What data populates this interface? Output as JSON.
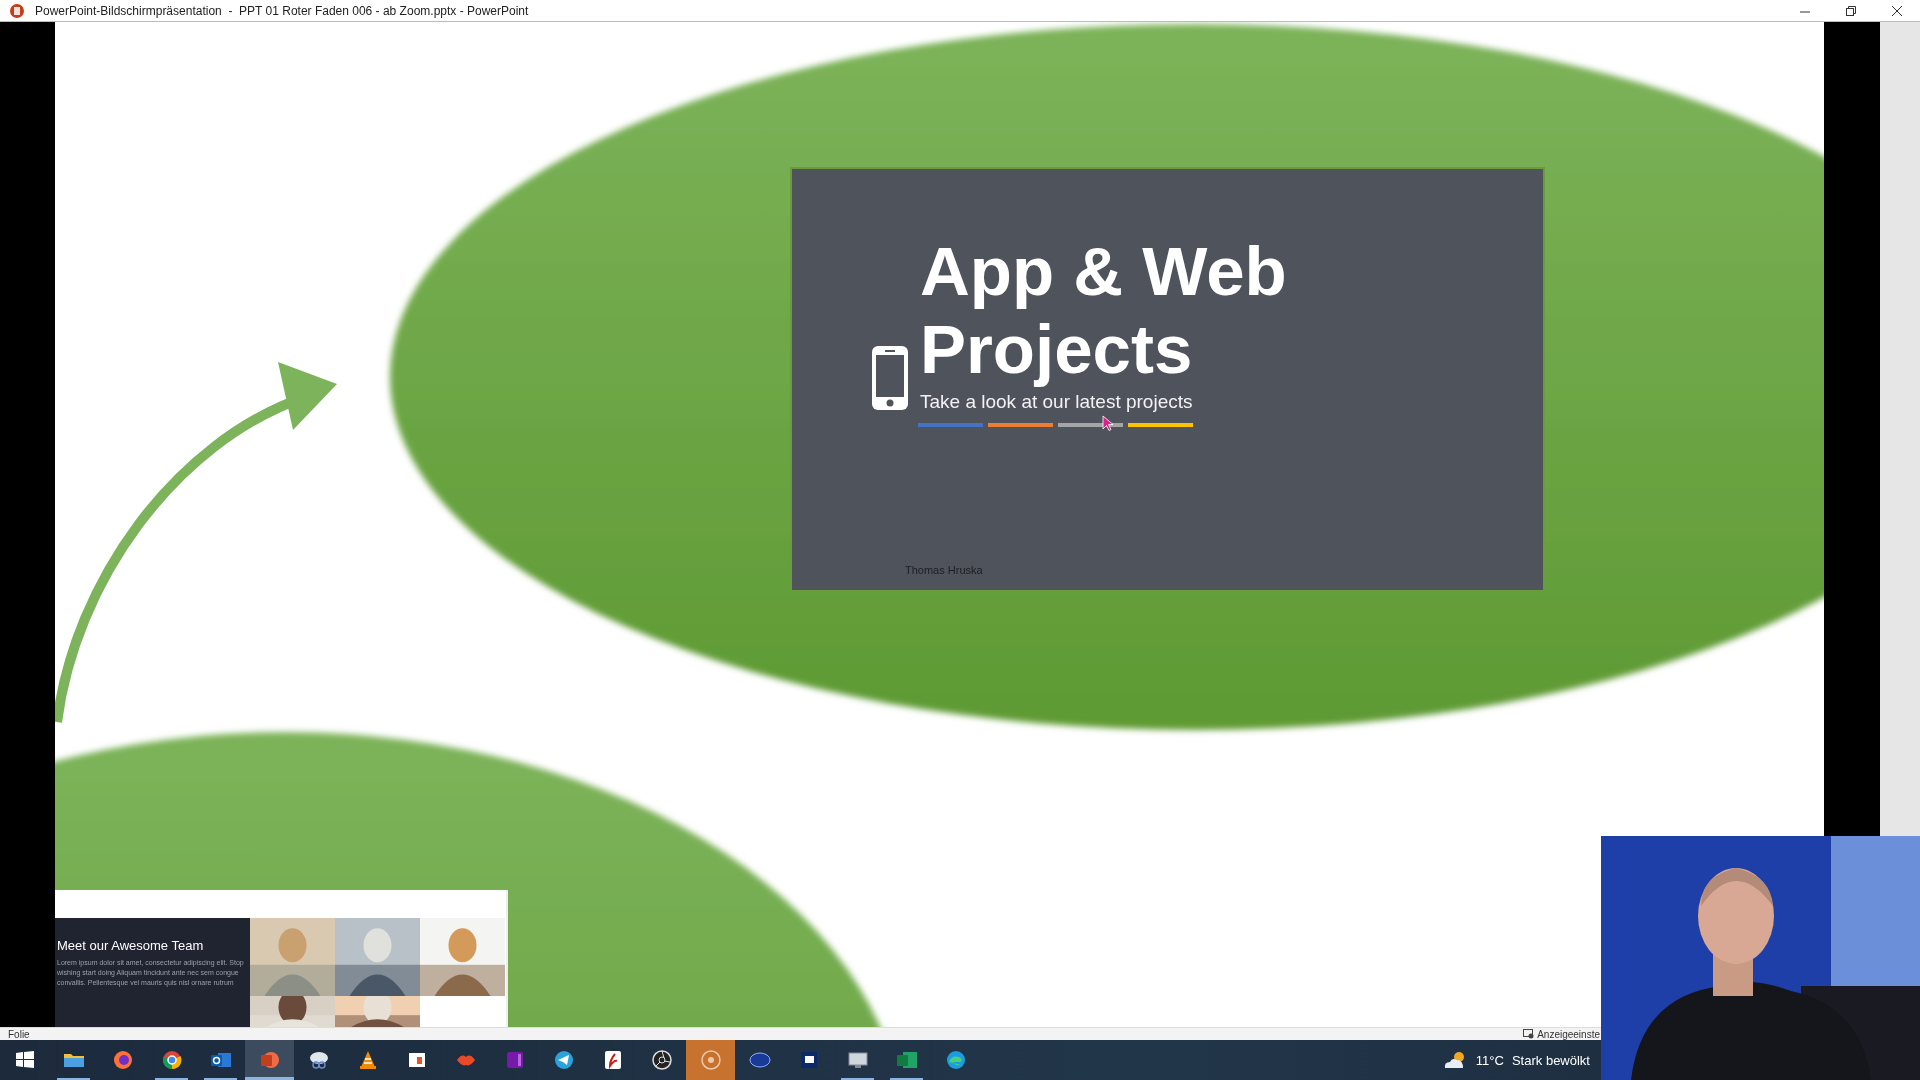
{
  "window": {
    "title": "PowerPoint-Bildschirmpräsentation  -  PPT 01 Roter Faden 006 - ab Zoom.pptx - PowerPoint",
    "controls": [
      {
        "kind": "minimize"
      },
      {
        "kind": "restore"
      },
      {
        "kind": "close"
      }
    ]
  },
  "slide": {
    "card": {
      "title": "App & Web Projects",
      "subtitle": "Take a look at our latest projects",
      "author": "Thomas Hruska",
      "accent_bars": [
        {
          "color": "#4472c4"
        },
        {
          "color": "#ed7d31"
        },
        {
          "color": "#a5a5a5"
        },
        {
          "color": "#ffc000"
        }
      ]
    },
    "thumbnail": {
      "heading": "Meet our Awesome Team",
      "body": "Lorem ipsum dolor sit amet, consectetur adipiscing elit. Stop wishing start doing Aliquam tincidunt ante nec sem congue convallis. Pellentesque vel mauris quis nisl ornare rutrum"
    }
  },
  "status_bar": {
    "left": "Folie",
    "right": "Anzeigeeinste"
  },
  "taskbar": {
    "apps": [
      {
        "kind": "start",
        "selected": false,
        "running": false
      },
      {
        "kind": "folder",
        "selected": false,
        "running": true
      },
      {
        "kind": "firefox",
        "selected": false,
        "running": false
      },
      {
        "kind": "chrome",
        "selected": false,
        "running": true
      },
      {
        "kind": "outlook",
        "selected": false,
        "running": true
      },
      {
        "kind": "powerpoint",
        "selected": true,
        "running": true
      },
      {
        "kind": "snip",
        "selected": false,
        "running": false
      },
      {
        "kind": "cone",
        "selected": false,
        "running": false
      },
      {
        "kind": "office",
        "selected": false,
        "running": false
      },
      {
        "kind": "lips",
        "selected": false,
        "running": false
      },
      {
        "kind": "notebook",
        "selected": false,
        "running": false
      },
      {
        "kind": "telegram",
        "selected": false,
        "running": false
      },
      {
        "kind": "acrobat",
        "selected": false,
        "running": false
      },
      {
        "kind": "aperture",
        "selected": false,
        "running": false
      },
      {
        "kind": "record",
        "selected": false,
        "running": false,
        "flashing": true
      },
      {
        "kind": "oval",
        "selected": false,
        "running": false
      },
      {
        "kind": "film",
        "selected": false,
        "running": false
      },
      {
        "kind": "monitor",
        "selected": false,
        "running": true
      },
      {
        "kind": "sheet",
        "selected": false,
        "running": true
      },
      {
        "kind": "edge",
        "selected": false,
        "running": false
      }
    ],
    "weather": {
      "temperature": "11°C",
      "condition": "Stark bewölkt"
    }
  }
}
